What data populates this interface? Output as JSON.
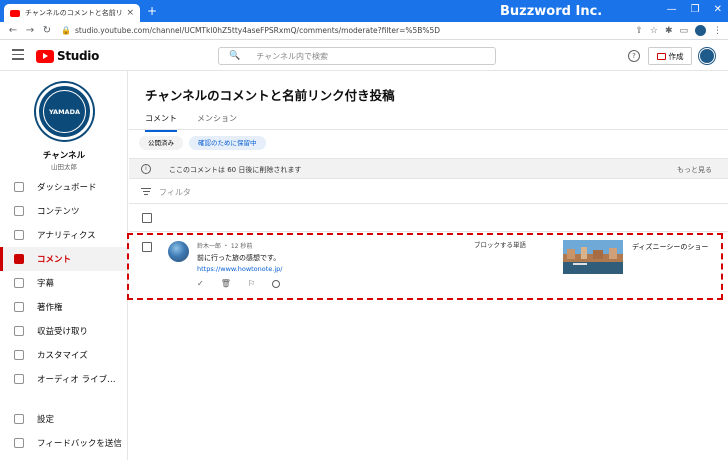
{
  "browser": {
    "tab_title": "チャンネルのコメントと名前リンク付き",
    "tab_close": "×",
    "new_tab": "+",
    "brand": "Buzzword Inc.",
    "win_min": "—",
    "win_max": "❐",
    "win_close": "✕",
    "url": "studio.youtube.com/channel/UCMTkl0hZ5tty4aseFPSRxmQ/comments/moderate?filter=%5B%5D",
    "nav_back": "←",
    "nav_forward": "→",
    "nav_reload": "↻",
    "lock": "🔒",
    "share": "⇪",
    "star": "☆",
    "ext": "✱",
    "sidepanel": "▭",
    "menu": "⋮"
  },
  "header": {
    "logo_text": "Studio",
    "search_icon": "🔍",
    "search_placeholder": "チャンネル内で検索",
    "help": "?",
    "create_label": "作成"
  },
  "sidebar": {
    "avatar_text": "YAMADA",
    "channel_title": "チャンネル",
    "channel_name": "山田太郎",
    "items": [
      {
        "label": "ダッシュボード",
        "icon": "dashboard-icon"
      },
      {
        "label": "コンテンツ",
        "icon": "content-icon"
      },
      {
        "label": "アナリティクス",
        "icon": "analytics-icon"
      },
      {
        "label": "コメント",
        "icon": "comments-icon"
      },
      {
        "label": "字幕",
        "icon": "subtitles-icon"
      },
      {
        "label": "著作権",
        "icon": "copyright-icon"
      },
      {
        "label": "収益受け取り",
        "icon": "monetization-icon"
      },
      {
        "label": "カスタマイズ",
        "icon": "customize-icon"
      },
      {
        "label": "オーディオ ライブ…",
        "icon": "audio-library-icon"
      }
    ],
    "bottom_items": [
      {
        "label": "設定",
        "icon": "settings-icon"
      },
      {
        "label": "フィードバックを送信",
        "icon": "feedback-icon"
      }
    ]
  },
  "main": {
    "title": "チャンネルのコメントと名前リンク付き投稿",
    "tabs": [
      {
        "label": "コメント"
      },
      {
        "label": "メンション"
      }
    ],
    "chips": [
      {
        "label": "公開済み"
      },
      {
        "label": "確認のために保留中"
      }
    ],
    "notice_icon": "i",
    "notice": "ここのコメントは 60 日後に削除されます",
    "notice_more": "もっと見る",
    "filter_placeholder": "フィルタ",
    "comment": {
      "meta": "鈴木一郎 ・ 12 秒前",
      "text": "前に行った旅の感想です。",
      "link": "https://www.howtonote.jp/",
      "act_approve": "✓",
      "act_delete": "🗑",
      "act_report": "⚐",
      "blocked_label": "ブロックする単語",
      "video_title": "ディズニーシーのショー"
    }
  }
}
